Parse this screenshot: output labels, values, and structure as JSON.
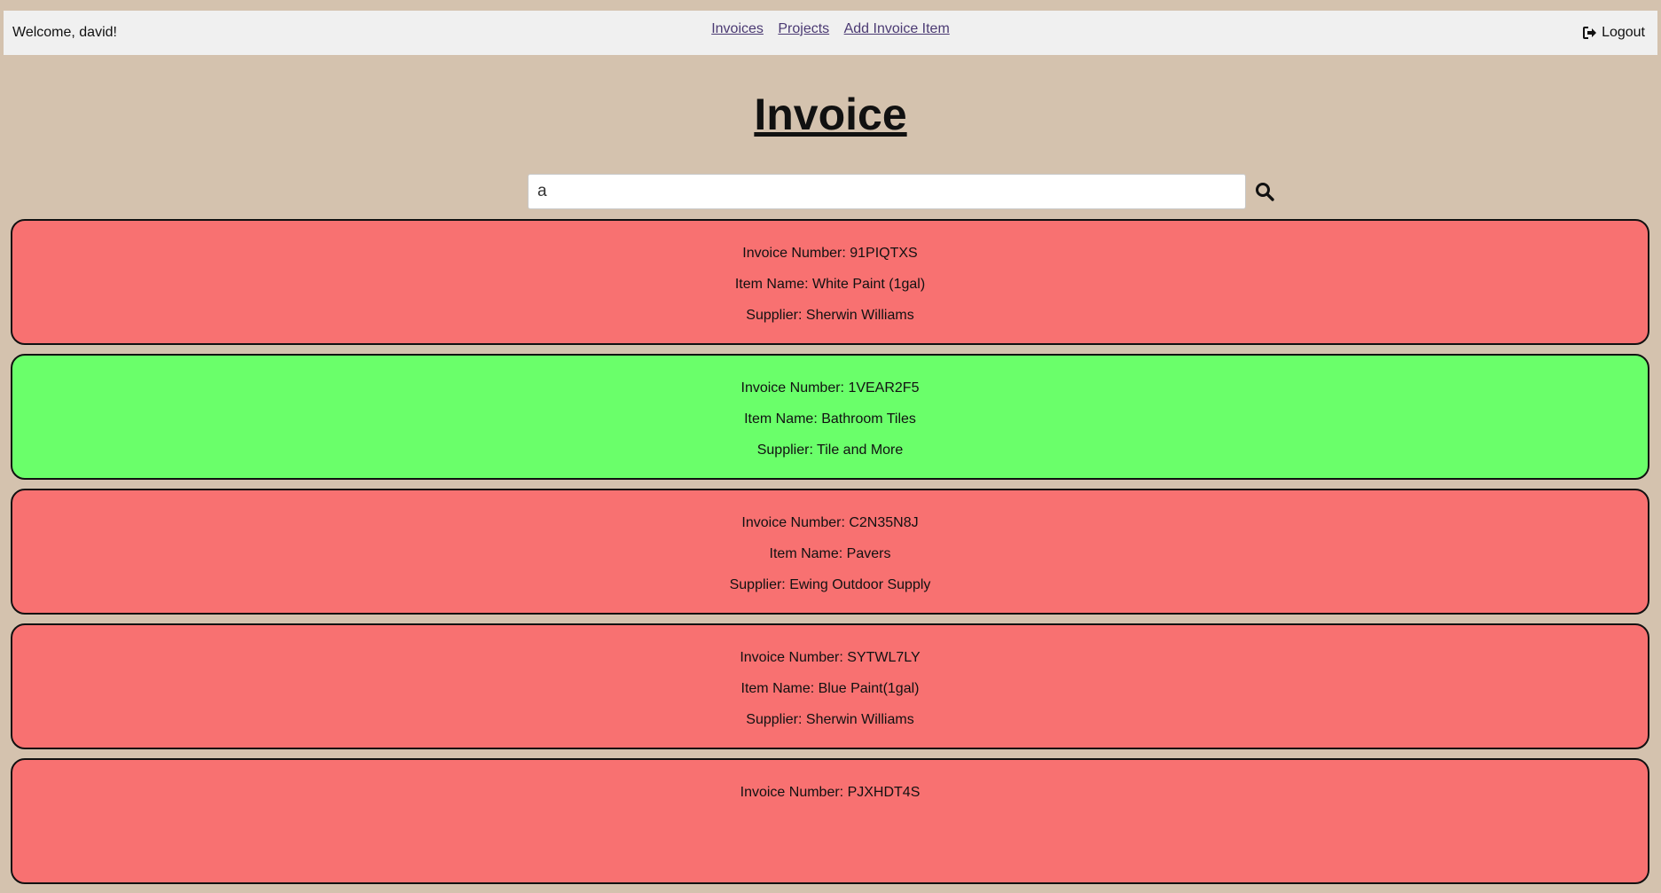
{
  "navbar": {
    "welcome": "Welcome, david!",
    "links": [
      "Invoices",
      "Projects",
      "Add Invoice Item"
    ],
    "logout": "Logout"
  },
  "page_title": "Invoice",
  "search": {
    "value": "a",
    "icon": "search-icon"
  },
  "colors": {
    "background": "#d4c2ae",
    "unpaid": "#f87171",
    "paid": "#6aff6a"
  },
  "invoices": [
    {
      "number": "Invoice Number: 91PIQTXS",
      "item": "Item Name: White Paint (1gal)",
      "supplier": "Supplier: Sherwin Williams",
      "status_color": "#f87171"
    },
    {
      "number": "Invoice Number: 1VEAR2F5",
      "item": "Item Name: Bathroom Tiles",
      "supplier": "Supplier: Tile and More",
      "status_color": "#6aff6a"
    },
    {
      "number": "Invoice Number: C2N35N8J",
      "item": "Item Name: Pavers",
      "supplier": "Supplier: Ewing Outdoor Supply",
      "status_color": "#f87171"
    },
    {
      "number": "Invoice Number: SYTWL7LY",
      "item": "Item Name: Blue Paint(1gal)",
      "supplier": "Supplier: Sherwin Williams",
      "status_color": "#f87171"
    },
    {
      "number": "Invoice Number: PJXHDT4S",
      "item": "",
      "supplier": "",
      "status_color": "#f87171"
    }
  ]
}
